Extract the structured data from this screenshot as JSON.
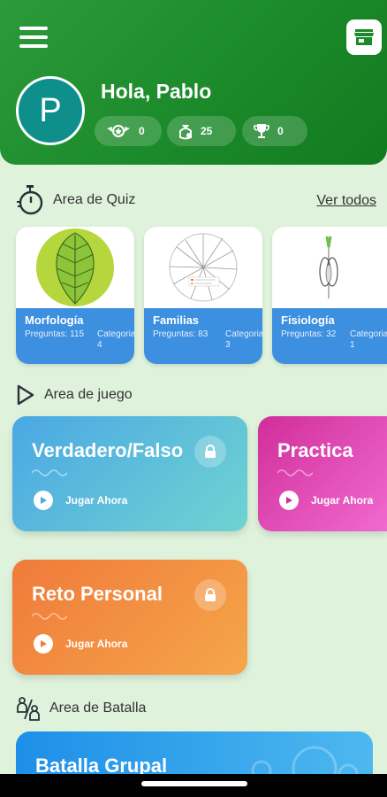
{
  "header": {
    "avatar_letter": "P",
    "greeting": "Hola, Pablo",
    "stats": [
      {
        "icon": "badge-icon",
        "value": "0"
      },
      {
        "icon": "coins-icon",
        "value": "25"
      },
      {
        "icon": "trophy-icon",
        "value": "0"
      }
    ]
  },
  "quiz_area": {
    "title": "Area de Quiz",
    "see_all": "Ver todos",
    "cards": [
      {
        "name": "Morfología",
        "questions": "Preguntas: 115",
        "category": "Categoria 4"
      },
      {
        "name": "Familias",
        "questions": "Preguntas: 83",
        "category": "Categoria 3"
      },
      {
        "name": "Fisiología",
        "questions": "Preguntas: 32",
        "category": "Categoria 1"
      }
    ]
  },
  "game_area": {
    "title": "Area de juego",
    "cards": [
      {
        "title": "Verdadero/Falso",
        "action": "Jugar Ahora"
      },
      {
        "title": "Practica",
        "action": "Jugar Ahora"
      },
      {
        "title": "Reto Personal",
        "action": "Jugar Ahora"
      }
    ]
  },
  "battle_area": {
    "title": "Area de Batalla",
    "card_title": "Batalla Grupal"
  },
  "colors": {
    "header_green": "#1b8a2a",
    "quiz_info_blue": "#3d8fe0",
    "verdadero_gradient": [
      "#4aa8e4",
      "#6fd3d0"
    ],
    "practica_gradient": [
      "#d12e9a",
      "#f06ad0"
    ],
    "reto_gradient": [
      "#f07a3a",
      "#f5a64a"
    ]
  }
}
